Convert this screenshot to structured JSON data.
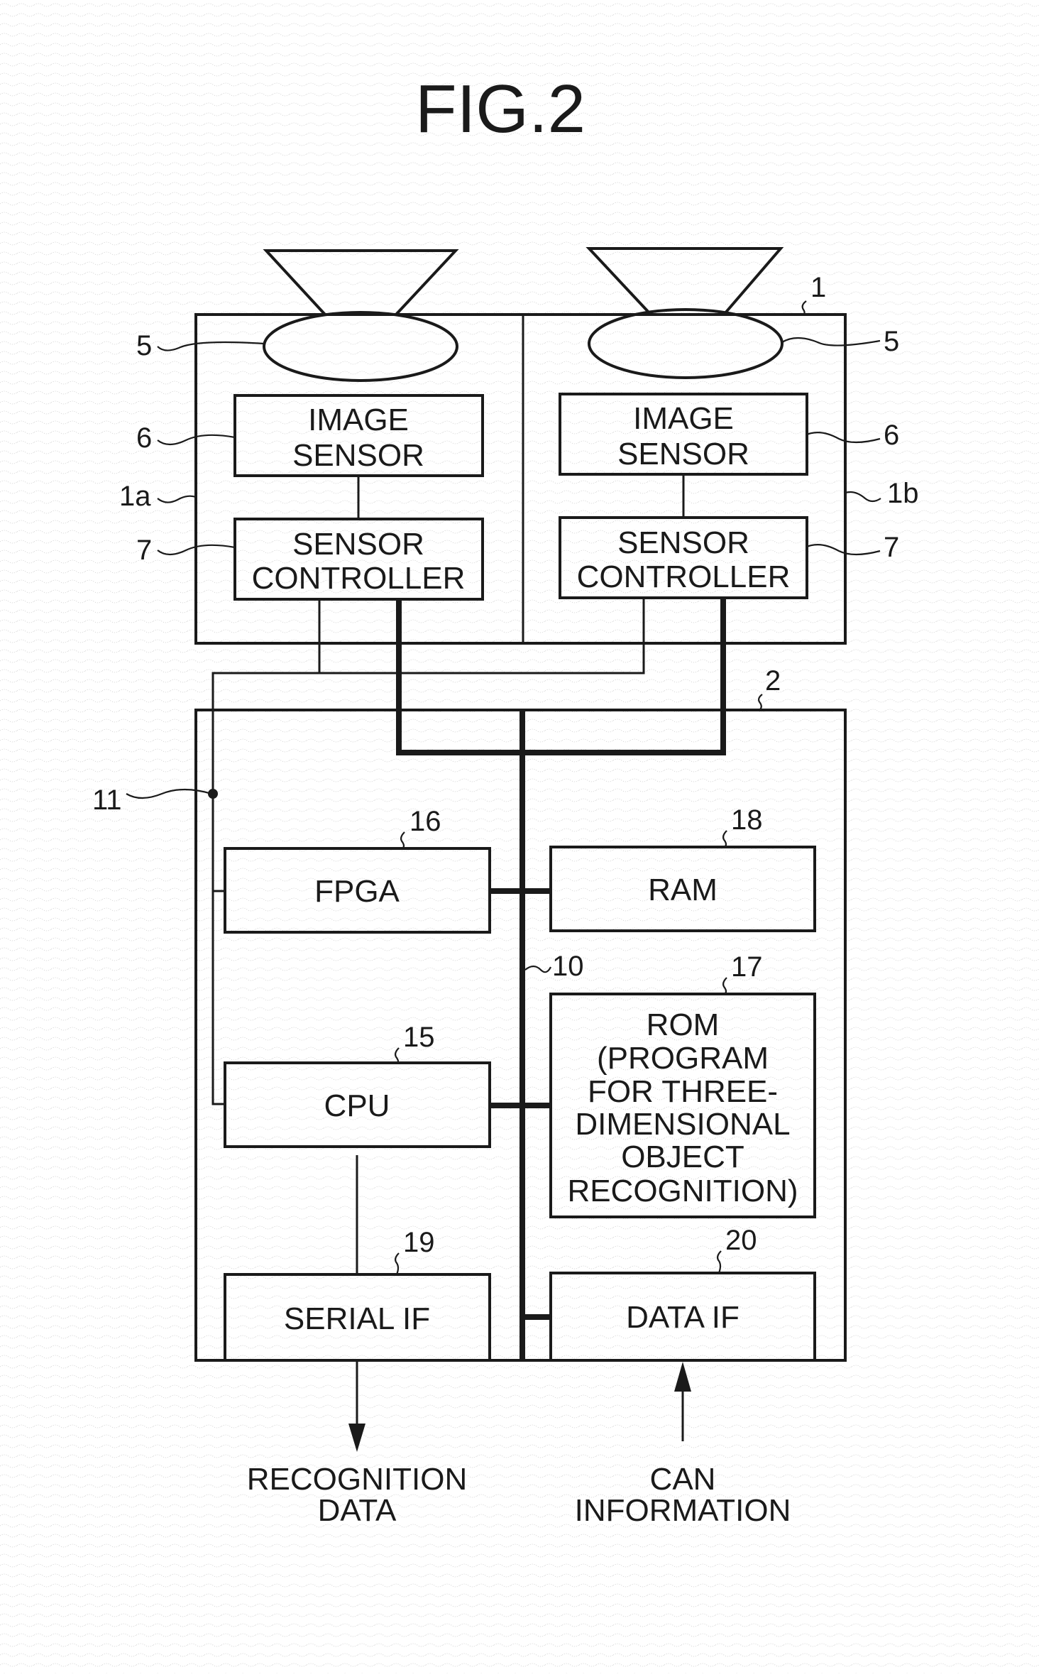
{
  "figure": {
    "title": "FIG.2"
  },
  "camera": {
    "ref": "1",
    "left_unit_ref": "1a",
    "right_unit_ref": "1b",
    "lens_ref": "5",
    "image_sensor": {
      "ref": "6",
      "lines": [
        "IMAGE",
        "SENSOR"
      ]
    },
    "sensor_controller": {
      "ref": "7",
      "lines": [
        "SENSOR",
        "CONTROLLER"
      ]
    }
  },
  "processing_unit": {
    "ref": "2",
    "bus_ref": "10",
    "serial_bus_ref": "11",
    "fpga": {
      "ref": "16",
      "label": "FPGA"
    },
    "ram": {
      "ref": "18",
      "label": "RAM"
    },
    "rom": {
      "ref": "17",
      "lines": [
        "ROM",
        "(PROGRAM",
        "FOR THREE-",
        "DIMENSIONAL",
        "OBJECT",
        "RECOGNITION)"
      ]
    },
    "cpu": {
      "ref": "15",
      "label": "CPU"
    },
    "serial_if": {
      "ref": "19",
      "label": "SERIAL IF"
    },
    "data_if": {
      "ref": "20",
      "label": "DATA IF"
    }
  },
  "outputs": {
    "recognition_data": [
      "RECOGNITION",
      "DATA"
    ],
    "can_information": [
      "CAN",
      "INFORMATION"
    ]
  }
}
